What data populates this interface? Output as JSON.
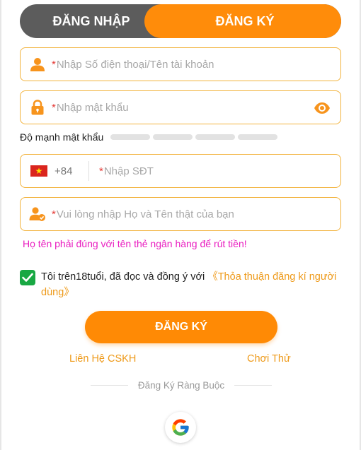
{
  "tabs": {
    "login_label": "ĐĂNG NHẬP",
    "register_label": "ĐĂNG KÝ"
  },
  "form": {
    "account": {
      "required_mark": "*",
      "placeholder": "Nhập Số điện thoại/Tên tài khoản",
      "icon": "user-icon"
    },
    "password": {
      "required_mark": "*",
      "placeholder": "Nhập mật khẩu",
      "icon": "lock-icon",
      "toggle_icon": "eye-icon"
    },
    "strength_label": "Độ mạnh mật khẩu",
    "phone": {
      "country_code": "+84",
      "flag": "vietnam-flag-icon",
      "required_mark": "*",
      "placeholder": "Nhập SĐT"
    },
    "fullname": {
      "required_mark": "*",
      "placeholder": "Vui lòng nhập Họ và Tên thật của bạn",
      "icon": "user-check-icon"
    },
    "name_hint": "Họ tên phải đúng với tên thẻ ngân hàng để rút tiền!",
    "agree": {
      "checked": true,
      "text": "Tôi trên18tuổi, đã đọc và đồng ý với ",
      "link": "《Thỏa thuận đăng kí người dùng》"
    },
    "submit_label": "ĐĂNG KÝ"
  },
  "footer": {
    "support_link": "Liên Hệ CSKH",
    "trial_link": "Chơi Thử",
    "bind_label": "Đăng Ký Ràng Buộc",
    "google_icon": "google-icon"
  },
  "colors": {
    "accent": "#ff8c0a",
    "tab_inactive": "#5c5c5c",
    "field_border": "#f2b33d",
    "hint": "#e91ec0",
    "check": "#18a843"
  }
}
